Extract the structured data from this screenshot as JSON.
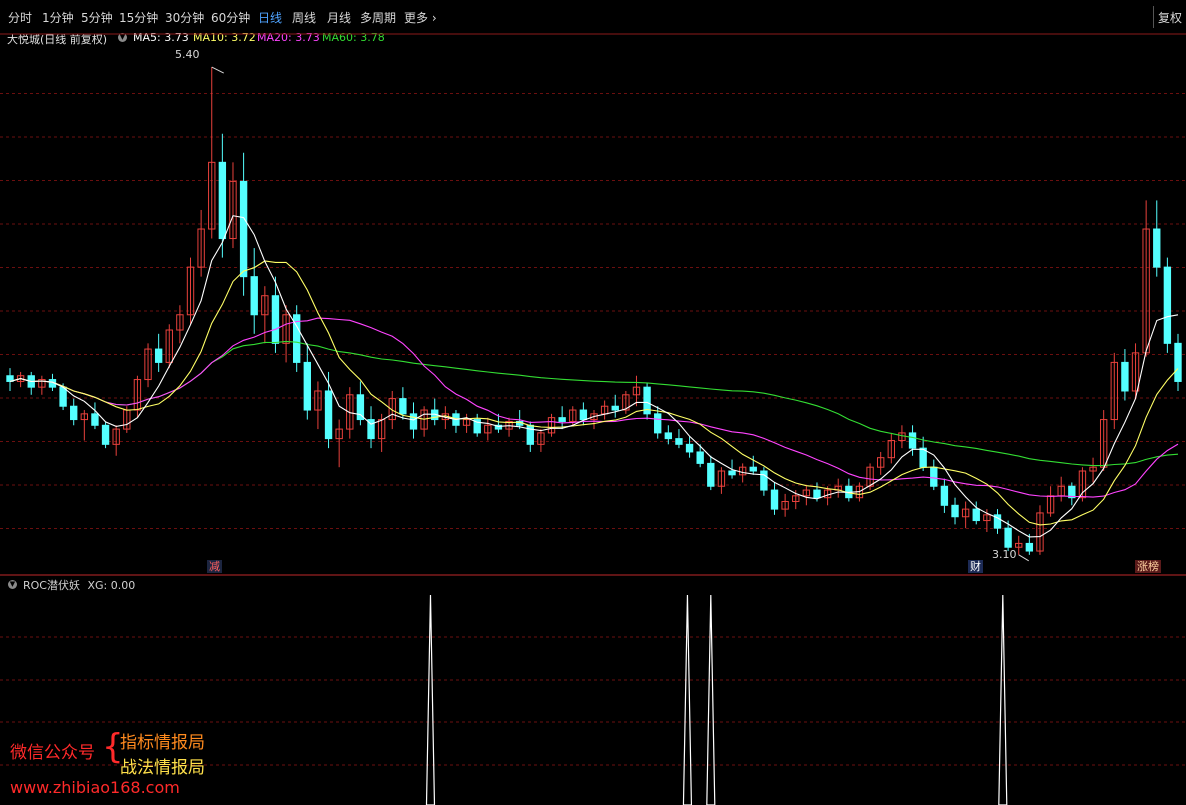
{
  "toolbar": {
    "tabs": [
      "分时",
      "1分钟",
      "5分钟",
      "15分钟",
      "30分钟",
      "60分钟",
      "日线",
      "周线",
      "月线",
      "多周期",
      "更多"
    ],
    "active_tab": "日线",
    "right_button": "复权"
  },
  "infobar": {
    "title": "大悦城(日线 前复权)",
    "ma5": "MA5: 3.73",
    "ma10": "MA10: 3.72",
    "ma20": "MA20: 3.73",
    "ma60": "MA60: 3.78"
  },
  "main_chart": {
    "high_label": "5.40",
    "low_label": "3.10",
    "markers": [
      "减",
      "财",
      "涨榜"
    ]
  },
  "sub_chart": {
    "label": "ROC潜伏妖",
    "value": "XG: 0.00"
  },
  "watermark": {
    "left": "微信公众号",
    "right1": "指标情报局",
    "right2": "战法情报局",
    "url": "www.zhibiao168.com"
  },
  "colors": {
    "up": "#e8413c",
    "down": "#54ffff",
    "ma5": "#ffffff",
    "ma10": "#ffff66",
    "ma20": "#ff44ff",
    "ma60": "#33dd33",
    "active_tab": "#4fa3ff",
    "grid": "#6b0f0f"
  },
  "chart_data": {
    "type": "candlestick",
    "ohlc": [
      [
        3.78,
        3.82,
        3.7,
        3.75
      ],
      [
        3.75,
        3.8,
        3.72,
        3.78
      ],
      [
        3.78,
        3.8,
        3.68,
        3.72
      ],
      [
        3.72,
        3.78,
        3.68,
        3.76
      ],
      [
        3.76,
        3.79,
        3.7,
        3.72
      ],
      [
        3.72,
        3.74,
        3.6,
        3.62
      ],
      [
        3.62,
        3.66,
        3.52,
        3.55
      ],
      [
        3.55,
        3.6,
        3.44,
        3.58
      ],
      [
        3.58,
        3.64,
        3.5,
        3.52
      ],
      [
        3.52,
        3.54,
        3.4,
        3.42
      ],
      [
        3.42,
        3.52,
        3.36,
        3.5
      ],
      [
        3.5,
        3.62,
        3.48,
        3.6
      ],
      [
        3.6,
        3.78,
        3.56,
        3.76
      ],
      [
        3.76,
        3.95,
        3.72,
        3.92
      ],
      [
        3.92,
        4.0,
        3.8,
        3.85
      ],
      [
        3.85,
        4.05,
        3.82,
        4.02
      ],
      [
        4.02,
        4.15,
        3.95,
        4.1
      ],
      [
        4.1,
        4.4,
        4.05,
        4.35
      ],
      [
        4.35,
        4.65,
        4.3,
        4.55
      ],
      [
        4.55,
        5.4,
        4.5,
        4.9
      ],
      [
        4.9,
        5.05,
        4.4,
        4.5
      ],
      [
        4.5,
        4.9,
        4.45,
        4.8
      ],
      [
        4.8,
        4.95,
        4.2,
        4.3
      ],
      [
        4.3,
        4.45,
        4.0,
        4.1
      ],
      [
        4.1,
        4.25,
        3.95,
        4.2
      ],
      [
        4.2,
        4.3,
        3.9,
        3.95
      ],
      [
        3.95,
        4.15,
        3.85,
        4.1
      ],
      [
        4.1,
        4.15,
        3.8,
        3.85
      ],
      [
        3.85,
        3.95,
        3.55,
        3.6
      ],
      [
        3.6,
        3.75,
        3.5,
        3.7
      ],
      [
        3.7,
        3.8,
        3.4,
        3.45
      ],
      [
        3.45,
        3.55,
        3.3,
        3.5
      ],
      [
        3.5,
        3.72,
        3.45,
        3.68
      ],
      [
        3.68,
        3.75,
        3.52,
        3.55
      ],
      [
        3.55,
        3.62,
        3.4,
        3.45
      ],
      [
        3.45,
        3.58,
        3.38,
        3.55
      ],
      [
        3.55,
        3.7,
        3.5,
        3.66
      ],
      [
        3.66,
        3.72,
        3.55,
        3.58
      ],
      [
        3.58,
        3.64,
        3.45,
        3.5
      ],
      [
        3.5,
        3.62,
        3.46,
        3.6
      ],
      [
        3.6,
        3.66,
        3.52,
        3.55
      ],
      [
        3.55,
        3.62,
        3.5,
        3.58
      ],
      [
        3.58,
        3.6,
        3.48,
        3.52
      ],
      [
        3.52,
        3.58,
        3.48,
        3.55
      ],
      [
        3.55,
        3.58,
        3.46,
        3.48
      ],
      [
        3.48,
        3.56,
        3.44,
        3.52
      ],
      [
        3.52,
        3.58,
        3.48,
        3.5
      ],
      [
        3.5,
        3.56,
        3.46,
        3.54
      ],
      [
        3.54,
        3.6,
        3.5,
        3.52
      ],
      [
        3.52,
        3.54,
        3.38,
        3.42
      ],
      [
        3.42,
        3.5,
        3.38,
        3.48
      ],
      [
        3.48,
        3.58,
        3.46,
        3.56
      ],
      [
        3.56,
        3.62,
        3.5,
        3.54
      ],
      [
        3.54,
        3.62,
        3.52,
        3.6
      ],
      [
        3.6,
        3.64,
        3.52,
        3.55
      ],
      [
        3.55,
        3.6,
        3.5,
        3.58
      ],
      [
        3.58,
        3.65,
        3.55,
        3.62
      ],
      [
        3.62,
        3.68,
        3.56,
        3.6
      ],
      [
        3.6,
        3.7,
        3.58,
        3.68
      ],
      [
        3.68,
        3.78,
        3.62,
        3.72
      ],
      [
        3.72,
        3.74,
        3.55,
        3.58
      ],
      [
        3.58,
        3.62,
        3.45,
        3.48
      ],
      [
        3.48,
        3.52,
        3.42,
        3.45
      ],
      [
        3.45,
        3.5,
        3.4,
        3.42
      ],
      [
        3.42,
        3.46,
        3.35,
        3.38
      ],
      [
        3.38,
        3.42,
        3.3,
        3.32
      ],
      [
        3.32,
        3.36,
        3.18,
        3.2
      ],
      [
        3.2,
        3.3,
        3.16,
        3.28
      ],
      [
        3.28,
        3.34,
        3.24,
        3.26
      ],
      [
        3.26,
        3.32,
        3.22,
        3.3
      ],
      [
        3.3,
        3.36,
        3.26,
        3.28
      ],
      [
        3.28,
        3.3,
        3.15,
        3.18
      ],
      [
        3.18,
        3.22,
        3.05,
        3.08
      ],
      [
        3.08,
        3.16,
        3.04,
        3.12
      ],
      [
        3.12,
        3.18,
        3.08,
        3.15
      ],
      [
        3.15,
        3.2,
        3.1,
        3.18
      ],
      [
        3.18,
        3.22,
        3.12,
        3.14
      ],
      [
        3.14,
        3.2,
        3.1,
        3.18
      ],
      [
        3.18,
        3.24,
        3.14,
        3.2
      ],
      [
        3.2,
        3.24,
        3.12,
        3.14
      ],
      [
        3.14,
        3.22,
        3.12,
        3.2
      ],
      [
        3.2,
        3.32,
        3.18,
        3.3
      ],
      [
        3.3,
        3.38,
        3.26,
        3.35
      ],
      [
        3.35,
        3.48,
        3.32,
        3.44
      ],
      [
        3.44,
        3.52,
        3.4,
        3.48
      ],
      [
        3.48,
        3.52,
        3.36,
        3.4
      ],
      [
        3.4,
        3.46,
        3.28,
        3.3
      ],
      [
        3.3,
        3.34,
        3.18,
        3.2
      ],
      [
        3.2,
        3.24,
        3.06,
        3.1
      ],
      [
        3.1,
        3.14,
        3.0,
        3.04
      ],
      [
        3.04,
        3.12,
        2.98,
        3.08
      ],
      [
        3.08,
        3.12,
        3.0,
        3.02
      ],
      [
        3.02,
        3.08,
        2.96,
        3.05
      ],
      [
        3.05,
        3.08,
        2.95,
        2.98
      ],
      [
        2.98,
        3.02,
        2.86,
        2.88
      ],
      [
        2.88,
        2.94,
        2.84,
        2.9
      ],
      [
        2.9,
        2.95,
        2.84,
        2.86
      ],
      [
        2.86,
        3.1,
        2.84,
        3.06
      ],
      [
        3.06,
        3.2,
        3.04,
        3.15
      ],
      [
        3.15,
        3.25,
        3.12,
        3.2
      ],
      [
        3.2,
        3.22,
        3.1,
        3.14
      ],
      [
        3.14,
        3.3,
        3.12,
        3.28
      ],
      [
        3.28,
        3.35,
        3.22,
        3.3
      ],
      [
        3.3,
        3.6,
        3.28,
        3.55
      ],
      [
        3.55,
        3.9,
        3.5,
        3.85
      ],
      [
        3.85,
        3.92,
        3.65,
        3.7
      ],
      [
        3.7,
        3.95,
        3.66,
        3.9
      ],
      [
        3.9,
        4.7,
        3.88,
        4.55
      ],
      [
        4.55,
        4.7,
        4.3,
        4.35
      ],
      [
        4.35,
        4.4,
        3.9,
        3.95
      ],
      [
        3.95,
        4.0,
        3.7,
        3.75
      ]
    ],
    "roc_signal_positions": [
      0.36,
      0.58,
      0.6,
      0.85
    ]
  }
}
